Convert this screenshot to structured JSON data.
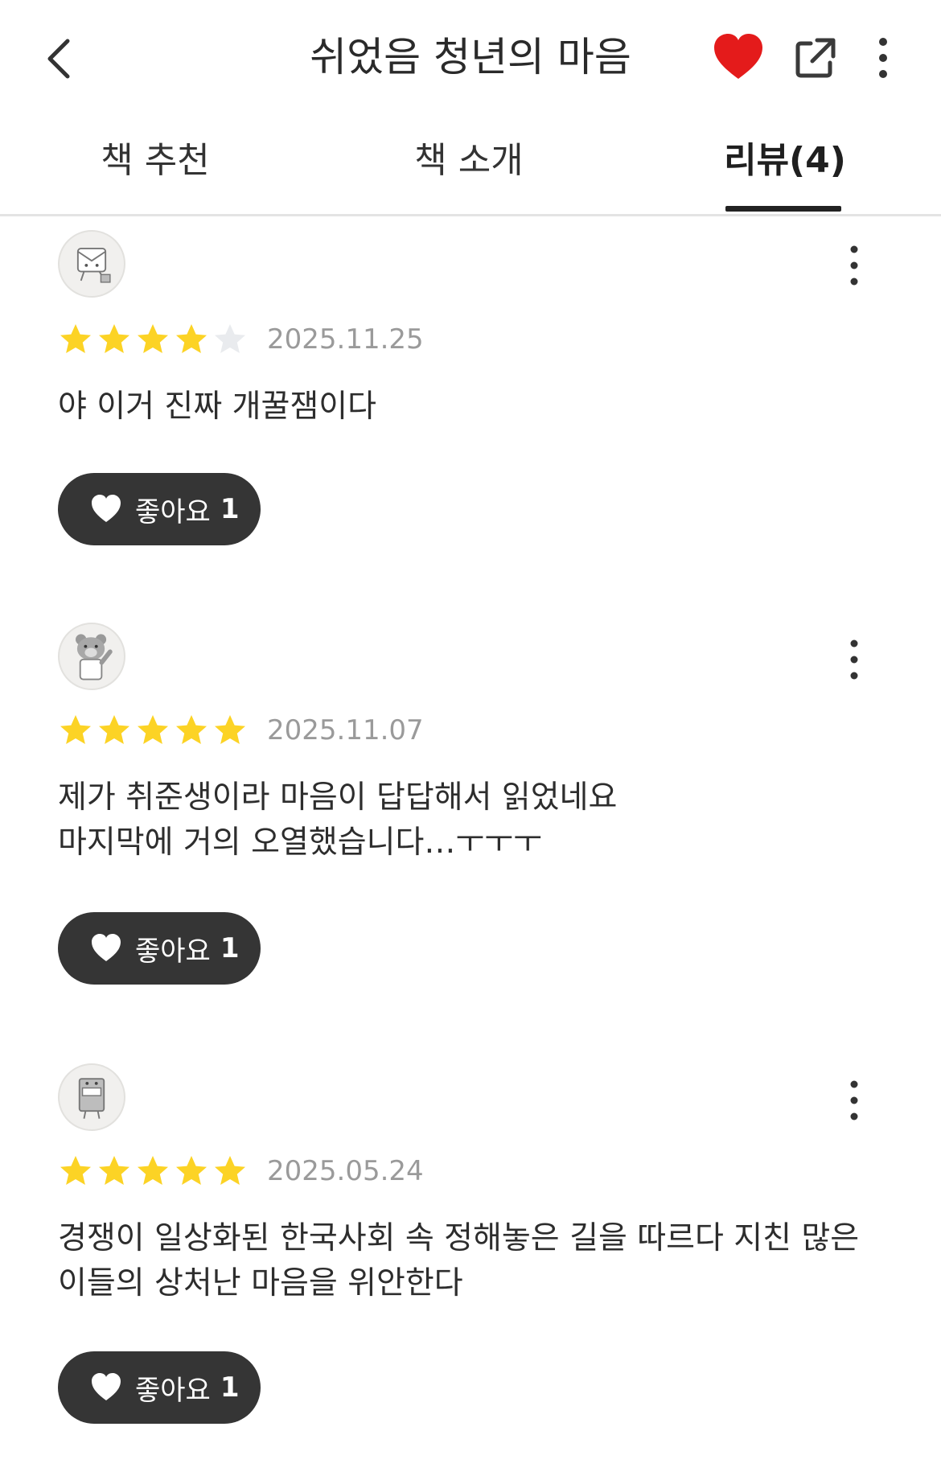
{
  "header": {
    "title": "쉬었음 청년의 마음",
    "favorite_color": "#e41b1b"
  },
  "tabs": [
    {
      "label": "책 추천",
      "active": false
    },
    {
      "label": "책 소개",
      "active": false
    },
    {
      "label": "리뷰(4)",
      "active": true
    }
  ],
  "like_label": "좋아요",
  "reviews": [
    {
      "avatar": "mailbox-character-icon",
      "rating": 4,
      "max_rating": 5,
      "date": "2025.11.25",
      "lines": [
        "야 이거 진짜 개꿀잼이다"
      ],
      "likes": "1"
    },
    {
      "avatar": "bear-character-icon",
      "rating": 5,
      "max_rating": 5,
      "date": "2025.11.07",
      "lines": [
        "제가 취준생이라 마음이 답답해서 읽었네요",
        "마지막에 거의 오열했습니다…ㅜㅜㅜ"
      ],
      "likes": "1"
    },
    {
      "avatar": "book-character-icon",
      "rating": 5,
      "max_rating": 5,
      "date": "2025.05.24",
      "lines": [
        "경쟁이 일상화된 한국사회 속 정해놓은 길을 따르다 지친 많은",
        "이들의 상처난 마음을 위안한다"
      ],
      "likes": "1"
    }
  ],
  "colors": {
    "star_filled": "#fcd325",
    "star_empty": "#e9ebee",
    "like_button_bg": "#353535"
  }
}
